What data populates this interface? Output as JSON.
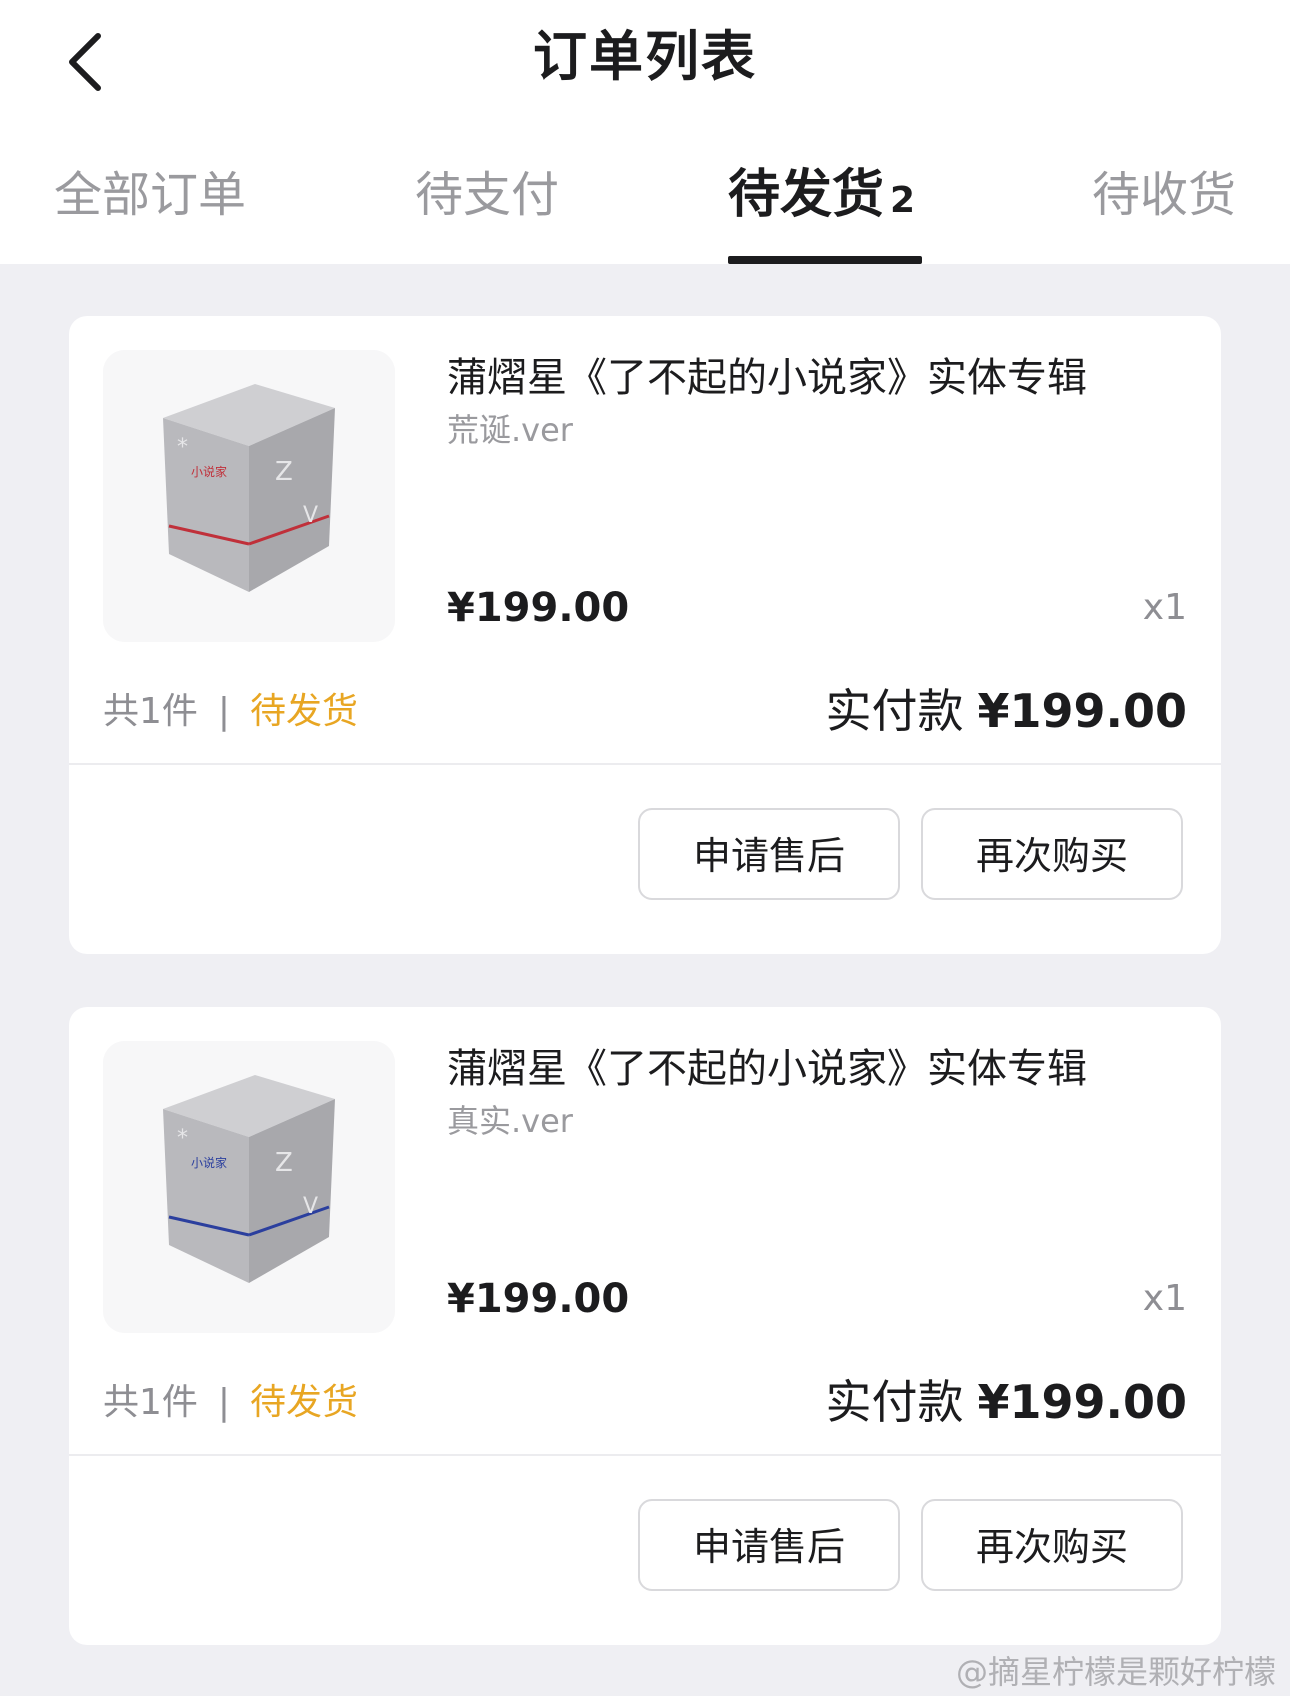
{
  "header": {
    "title": "订单列表",
    "back_icon": "chevron-left-icon"
  },
  "tabs": [
    {
      "label": "全部订单",
      "active": false
    },
    {
      "label": "待支付",
      "active": false
    },
    {
      "label": "待发货",
      "active": true,
      "count": "2"
    },
    {
      "label": "待收货",
      "active": false
    }
  ],
  "orders": [
    {
      "title": "蒲熠星《了不起的小说家》实体专辑",
      "variant": "荒诞.ver",
      "price": "¥199.00",
      "quantity": "x1",
      "item_count": "共1件",
      "separator": "|",
      "status": "待发货",
      "paid_label": "实付款",
      "paid_amount": "¥199.00",
      "buttons": {
        "after_sale": "申请售后",
        "rebuy": "再次购买"
      },
      "band_color": "#c0303a"
    },
    {
      "title": "蒲熠星《了不起的小说家》实体专辑",
      "variant": "真实.ver",
      "price": "¥199.00",
      "quantity": "x1",
      "item_count": "共1件",
      "separator": "|",
      "status": "待发货",
      "paid_label": "实付款",
      "paid_amount": "¥199.00",
      "buttons": {
        "after_sale": "申请售后",
        "rebuy": "再次购买"
      },
      "band_color": "#2b3f9e"
    }
  ],
  "watermark": "@摘星柠檬是颗好柠檬",
  "colors": {
    "status": "#e8a623",
    "background": "#efeff3",
    "card": "#ffffff"
  }
}
